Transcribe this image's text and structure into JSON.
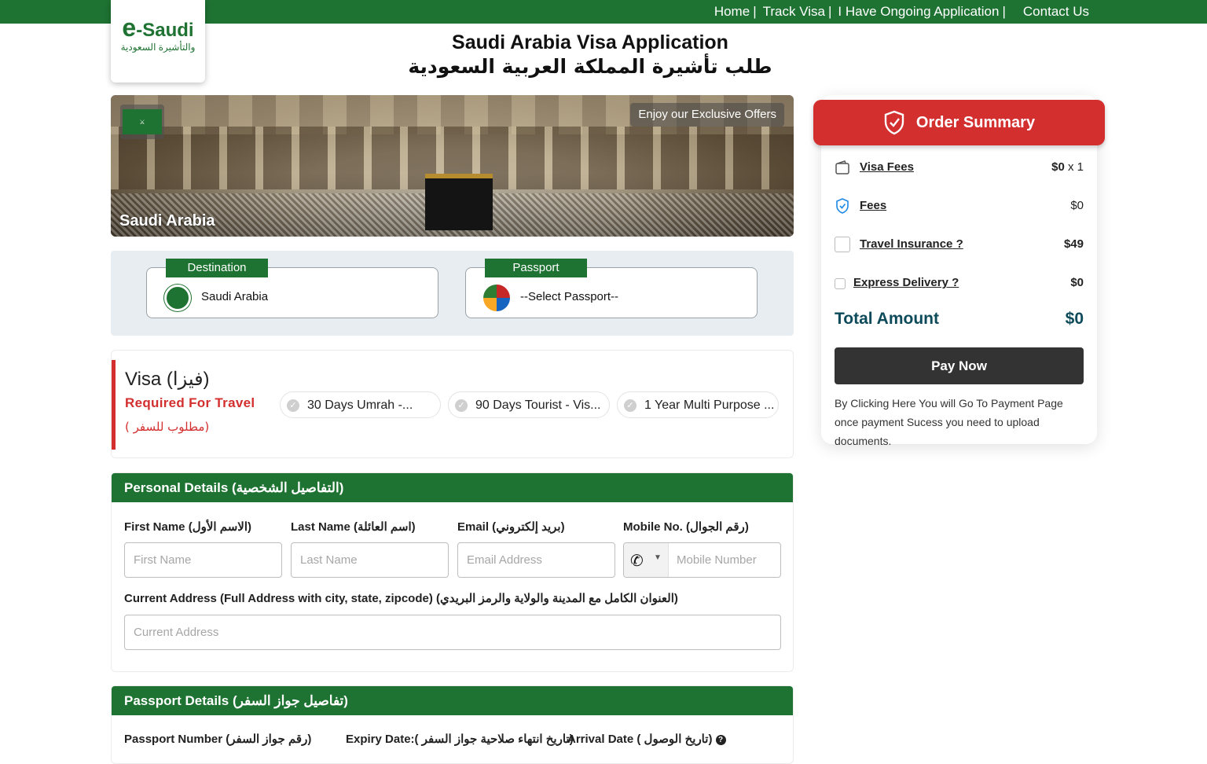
{
  "nav": {
    "home": "Home",
    "track": "Track Visa",
    "ongoing": "I Have Ongoing Application",
    "contact": "Contact Us",
    "sep": "|"
  },
  "logo": {
    "e": "e",
    "name": "-Saudi",
    "arabic": "والتأشيرة السعودية"
  },
  "header": {
    "title": "Saudi Arabia Visa Application",
    "title_ar": "طلب تأشيرة المملكة العربية السعودية"
  },
  "banner": {
    "offer": "Enjoy our Exclusive Offers",
    "caption": "Saudi Arabia"
  },
  "destination": {
    "tag": "Destination",
    "value": "Saudi Arabia"
  },
  "passport": {
    "tag": "Passport",
    "value": "--Select Passport--"
  },
  "visa": {
    "title": "Visa (فيزا)",
    "required": "Required For Travel",
    "required_ar": "( مطلوب للسفر)",
    "options": [
      "30 Days Umrah -...",
      "90 Days Tourist - Vis...",
      "1 Year Multi Purpose ..."
    ]
  },
  "personal": {
    "heading": "Personal Details (التفاصيل الشخصية)",
    "first_name_label": "First Name (الاسم الأول)",
    "first_name_placeholder": "First Name",
    "last_name_label": "Last Name (اسم العائلة)",
    "last_name_placeholder": "Last Name",
    "email_label": "Email (بريد إلكتروني)",
    "email_placeholder": "Email Address",
    "mobile_label": "Mobile No. (رقم الجوال)",
    "mobile_placeholder": "Mobile Number",
    "address_label": "Current Address (Full Address with city, state, zipcode) (العنوان الكامل مع المدينة والولاية والرمز البريدي)",
    "address_placeholder": "Current Address"
  },
  "passport_details": {
    "heading": "Passport Details (تفاصيل جواز السفر)",
    "number_label": "Passport Number (رقم جواز السفر)",
    "expiry_label": "Expiry Date:( تاريخ انتهاء صلاحية جواز السفر)",
    "arrival_label": "Arrival Date ( تاريخ الوصول)"
  },
  "order": {
    "title": "Order Summary",
    "visa_fees_label": "Visa Fees",
    "visa_fees_value": "$0",
    "visa_fees_qty": " x 1",
    "fees_label": "Fees",
    "fees_value": "$0",
    "insurance_label": "Travel Insurance",
    "insurance_q": " ?",
    "insurance_value": "$49",
    "delivery_label": "Express Delivery",
    "delivery_q": " ?",
    "delivery_value": "$0",
    "total_label": "Total Amount",
    "total_value": "$0",
    "pay_button": "Pay Now",
    "note": "By Clicking Here You will Go To Payment Page once payment Sucess you need to upload documents."
  },
  "colors": {
    "brand_green": "#1e7232",
    "accent_red": "#d32f2f",
    "pay_button": "#333333",
    "total_text": "#0d4a5a"
  },
  "icons": {
    "phone": "phone-icon",
    "shield": "shield-check-icon",
    "wallet": "wallet-icon",
    "badge": "badge-check-icon",
    "check": "check-circle-icon"
  }
}
